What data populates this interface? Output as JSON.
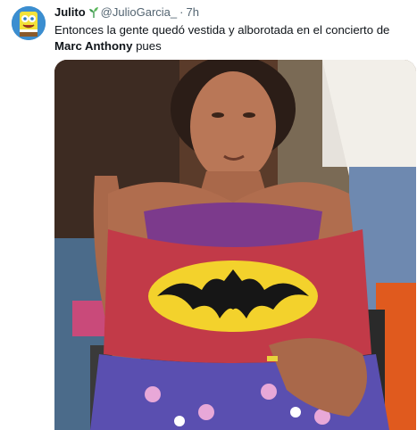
{
  "tweet": {
    "display_name": "Julito",
    "name_icon": "seedling-icon",
    "handle": "@JulioGarcia_",
    "separator": "·",
    "timestamp": "7h",
    "text_before": "Entonces la gente quedó vestida y alborotada en el concierto de ",
    "text_bold": "Marc Anthony",
    "text_after": " pues",
    "avatar_icon": "spongebob-avatar",
    "media_description_icon": "photo-woman-batman-shirt"
  },
  "colors": {
    "text_primary": "#0f1419",
    "text_secondary": "#536471",
    "sprout_green": "#3e9b4f"
  }
}
